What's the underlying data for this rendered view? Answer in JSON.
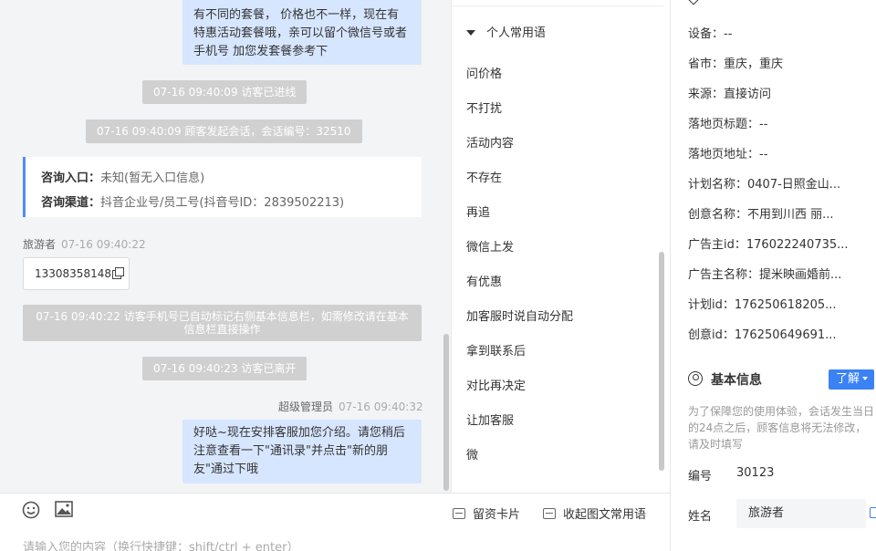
{
  "chat": {
    "msg_top": "有不同的套餐， 价格也不一样，现在有特惠活动套餐哦，亲可以留个微信号或者手机号 加您发套餐参考下",
    "sys_enter": "07-16 09:40:09 访客已进线",
    "sys_start": "07-16 09:40:09 顾客发起会话，会话编号：32510",
    "info_label_entry": "咨询入口：",
    "info_value_entry": "未知(暂无入口信息)",
    "info_label_channel": "咨询渠道：",
    "info_value_channel": "抖音企业号/员工号(抖音号ID：2839502213)",
    "visitor_name": "旅游者",
    "visitor_time": "07-16 09:40:22",
    "visitor_phone": "13308358148",
    "sys_phone": "07-16 09:40:22 访客手机号已自动标记右侧基本信息栏，如需修改请在基本信息栏直接操作",
    "sys_leave": "07-16 09:40:23 访客已离开",
    "agent_name": "超级管理员",
    "agent_time": "07-16 09:40:32",
    "msg_bottom": "好哒~现在安排客服加您介绍。请您稍后注意查看一下\"通讯录\"并点击\"新的朋友\"通过下哦"
  },
  "input_bar": {
    "card_label": "留资卡片",
    "phrase_label": "收起图文常用语",
    "placeholder": "请输入您的内容（换行快捷键：shift/ctrl + enter）"
  },
  "phrases": {
    "group_title": "个人常用语",
    "items": [
      "问价格",
      "不打扰",
      "活动内容",
      "不存在",
      "再追",
      "微信上发",
      "有优惠",
      "加客服时说自动分配",
      "拿到联系后",
      "对比再决定",
      "让加客服",
      "微"
    ]
  },
  "visitor_info": {
    "fields": [
      {
        "label": "设备：",
        "value": "--"
      },
      {
        "label": "省市：",
        "value": "重庆，重庆"
      },
      {
        "label": "来源：",
        "value": "直接访问"
      },
      {
        "label": "落地页标题：",
        "value": "--"
      },
      {
        "label": "落地页地址：",
        "value": "--"
      },
      {
        "label": "计划名称：",
        "value": "0407-日照金山..."
      },
      {
        "label": "创意名称：",
        "value": "不用到川西 丽..."
      },
      {
        "label": "广告主id：",
        "value": "176022240735..."
      },
      {
        "label": "广告主名称：",
        "value": "提米映画婚前..."
      },
      {
        "label": "计划id：",
        "value": "176250618205..."
      },
      {
        "label": "创意id：",
        "value": "176250649691..."
      }
    ]
  },
  "basic_info": {
    "title": "基本信息",
    "learn_more": "了解",
    "notice": "为了保障您的使用体验，会话发生当日的24点之后，顾客信息将无法修改，请及时填写",
    "id_label": "编号",
    "id_value": "30123",
    "name_label": "姓名",
    "name_value": "旅游者"
  },
  "colors": {
    "accent": "#3b82f6",
    "bubble": "#d7e6ff",
    "system_pill": "#d0d0d0",
    "chat_bg": "#f3f4f6"
  }
}
